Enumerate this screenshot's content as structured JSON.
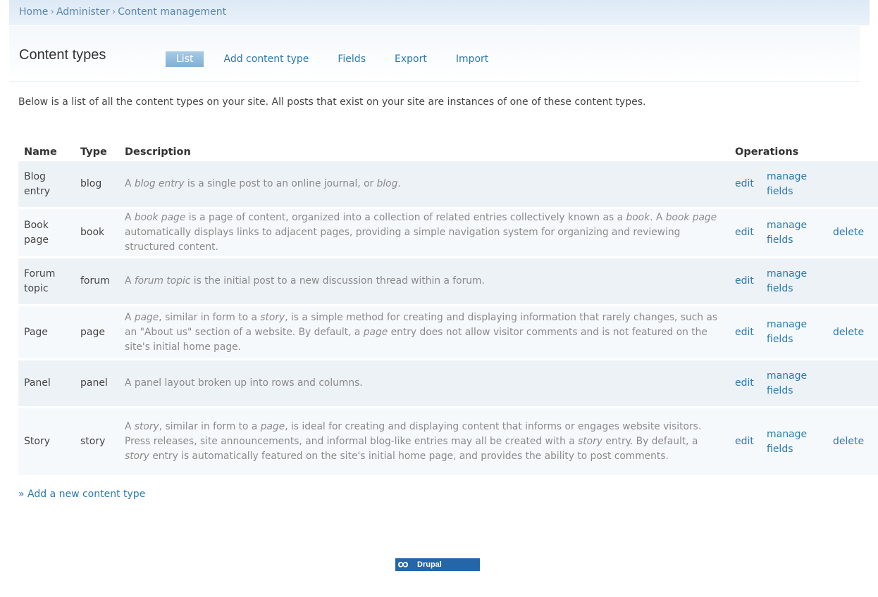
{
  "breadcrumb": [
    "Home",
    "Administer",
    "Content management"
  ],
  "breadcrumb_separator": "›",
  "page_title": "Content types",
  "tabs": [
    "List",
    "Add content type",
    "Fields",
    "Export",
    "Import"
  ],
  "intro": "Below is a list of all the content types on your site. All posts that exist on your site are instances of one of these content types.",
  "table": {
    "headers": [
      "Name",
      "Type",
      "Description",
      "Operations"
    ],
    "rows": [
      {
        "name_line1": "Blog",
        "name_line2": "entry",
        "type": "blog",
        "desc": [
          {
            "t": "A "
          },
          {
            "i": "blog entry"
          },
          {
            "t": " is a single post to an online journal, or "
          },
          {
            "i": "blog"
          },
          {
            "t": "."
          }
        ],
        "edit": "edit",
        "manage_line1": "manage",
        "manage_line2": "fields",
        "delete": ""
      },
      {
        "name_line1": "Book",
        "name_line2": "page",
        "type": "book",
        "desc": [
          {
            "t": "A "
          },
          {
            "i": "book page"
          },
          {
            "t": " is a page of content, organized into a collection of related entries collectively known as a "
          },
          {
            "i": "book"
          },
          {
            "t": ". A "
          },
          {
            "i": "book page"
          },
          {
            "t": " automatically displays links to adjacent pages, providing a simple navigation system for organizing and reviewing structured content."
          }
        ],
        "edit": "edit",
        "manage_line1": "manage",
        "manage_line2": "fields",
        "delete": "delete"
      },
      {
        "name_line1": "Forum",
        "name_line2": "topic",
        "type": "forum",
        "desc": [
          {
            "t": "A "
          },
          {
            "i": "forum topic"
          },
          {
            "t": " is the initial post to a new discussion thread within a forum."
          }
        ],
        "edit": "edit",
        "manage_line1": "manage",
        "manage_line2": "fields",
        "delete": ""
      },
      {
        "name_line1": "Page",
        "name_line2": "",
        "type": "page",
        "desc": [
          {
            "t": "A "
          },
          {
            "i": "page"
          },
          {
            "t": ", similar in form to a "
          },
          {
            "i": "story"
          },
          {
            "t": ", is a simple method for creating and displaying information that rarely changes, such as an \"About us\" section of a website. By default, a "
          },
          {
            "i": "page"
          },
          {
            "t": " entry does not allow visitor comments and is not featured on the site's initial home page."
          }
        ],
        "edit": "edit",
        "manage_line1": "manage",
        "manage_line2": "fields",
        "delete": "delete"
      },
      {
        "name_line1": "Panel",
        "name_line2": "",
        "type": "panel",
        "desc": [
          {
            "t": "A panel layout broken up into rows and columns."
          }
        ],
        "edit": "edit",
        "manage_line1": "manage",
        "manage_line2": "fields",
        "delete": ""
      },
      {
        "name_line1": "Story",
        "name_line2": "",
        "type": "story",
        "desc": [
          {
            "t": "A "
          },
          {
            "i": "story"
          },
          {
            "t": ", similar in form to a "
          },
          {
            "i": "page"
          },
          {
            "t": ", is ideal for creating and displaying content that informs or engages website visitors. Press releases, site announcements, and informal blog-like entries may all be created with a "
          },
          {
            "i": "story"
          },
          {
            "t": " entry. By default, a "
          },
          {
            "i": "story"
          },
          {
            "t": " entry is automatically featured on the site's initial home page, and provides the ability to post comments."
          }
        ],
        "edit": "edit",
        "manage_line1": "manage",
        "manage_line2": "fields",
        "delete": "delete"
      }
    ]
  },
  "add_link": "» Add a new content type",
  "footer_badge": "Drupal",
  "colors": {
    "link": "#2b7ab0",
    "active_tab": "#8fbcdf",
    "row_odd": "#edf2f7",
    "row_even": "#f6f9fb",
    "badge": "#2466a8"
  }
}
